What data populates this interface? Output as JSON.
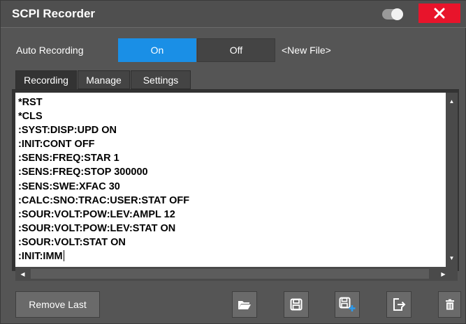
{
  "window": {
    "title": "SCPI Recorder"
  },
  "auto_recording": {
    "label": "Auto Recording",
    "on_label": "On",
    "off_label": "Off",
    "selected": "On",
    "file_label": "<New File>"
  },
  "tabs": [
    {
      "label": "Recording",
      "active": true
    },
    {
      "label": "Manage",
      "active": false
    },
    {
      "label": "Settings",
      "active": false
    }
  ],
  "commands": [
    "*RST",
    "*CLS",
    ":SYST:DISP:UPD ON",
    ":INIT:CONT OFF",
    ":SENS:FREQ:STAR 1",
    ":SENS:FREQ:STOP 300000",
    ":SENS:SWE:XFAC 30",
    ":CALC:SNO:TRAC:USER:STAT OFF",
    ":SOUR:VOLT:POW:LEV:AMPL 12",
    ":SOUR:VOLT:POW:LEV:STAT ON",
    ":SOUR:VOLT:STAT ON",
    ":INIT:IMM"
  ],
  "toolbar": {
    "remove_last_label": "Remove Last",
    "icons": [
      "open-folder-icon",
      "save-icon",
      "save-as-icon",
      "export-icon",
      "trash-icon"
    ]
  },
  "colors": {
    "accent": "#1a8fe6",
    "close": "#e8142b",
    "background": "#555555"
  }
}
